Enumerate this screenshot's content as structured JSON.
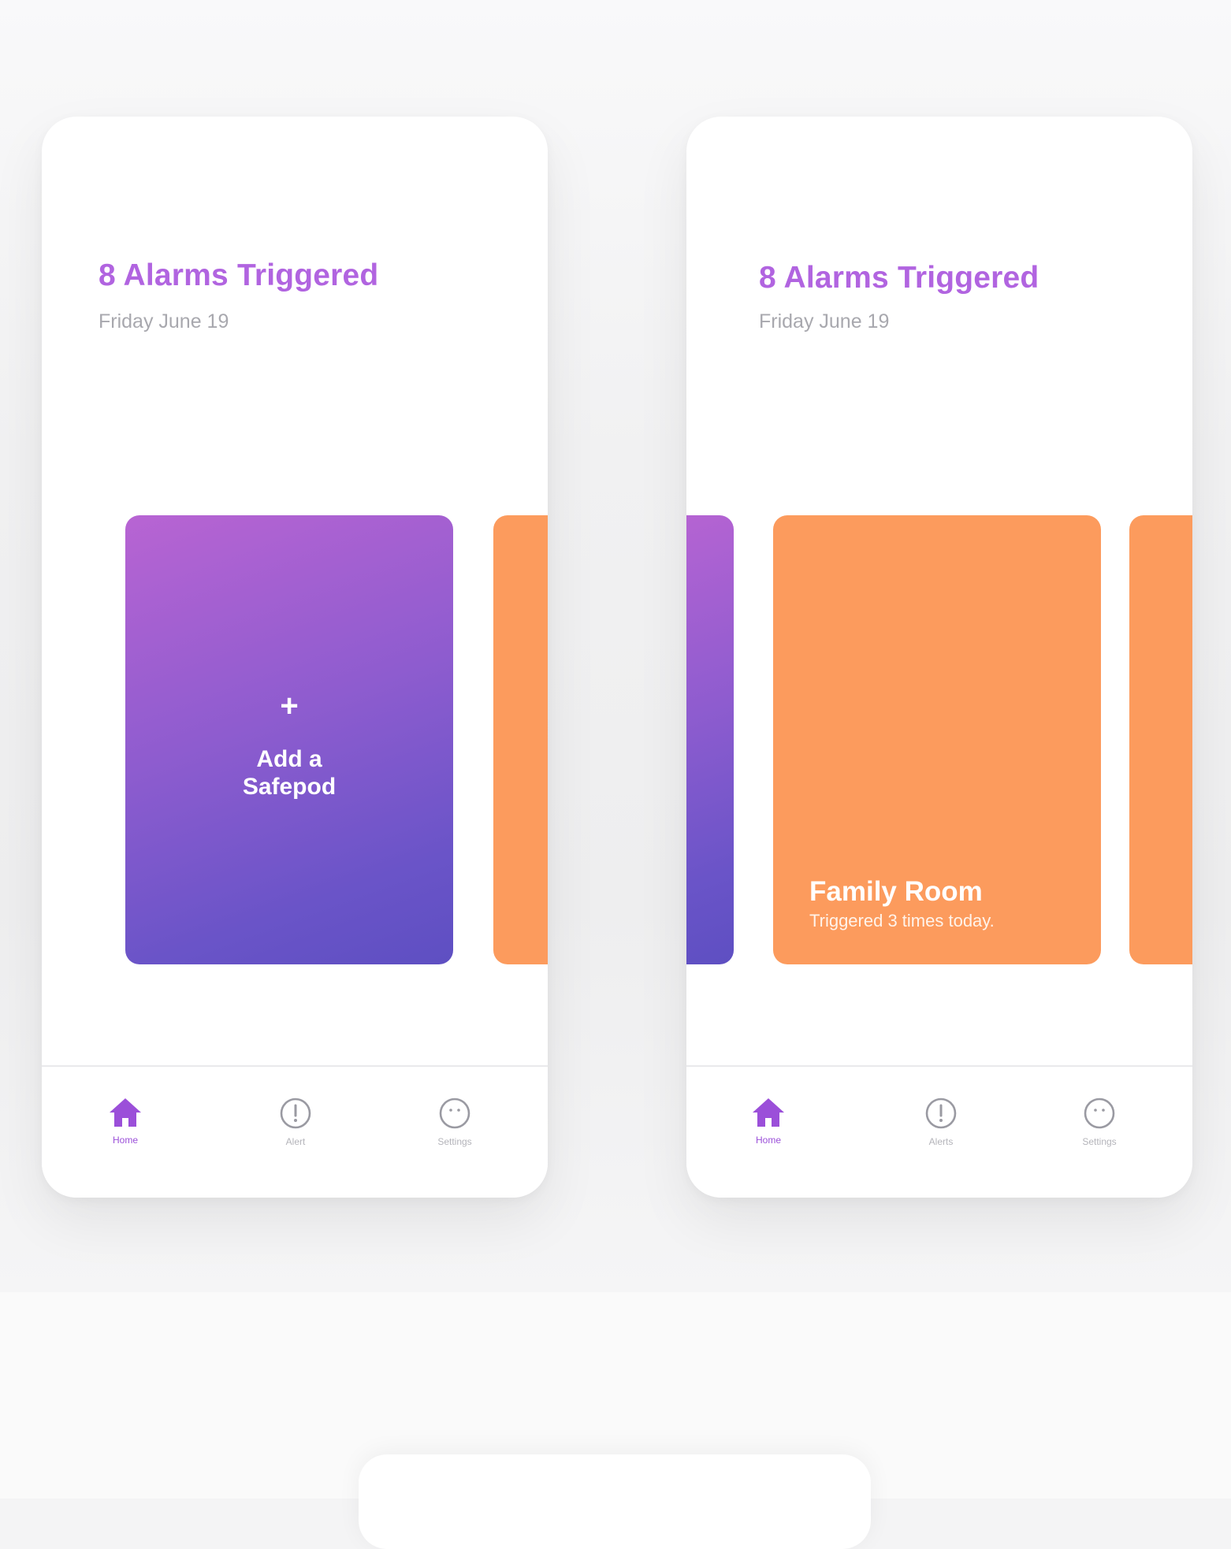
{
  "screens": [
    {
      "title": "8 Alarms Triggered",
      "date": "Friday June 19",
      "add_card": {
        "plus_symbol": "+",
        "label": "Add a Safepod"
      },
      "tabs": [
        {
          "label": "Home",
          "icon": "home-icon",
          "active": true
        },
        {
          "label": "Alert",
          "icon": "alert-icon",
          "active": false
        },
        {
          "label": "Settings",
          "icon": "settings-icon",
          "active": false
        }
      ]
    },
    {
      "title": "8 Alarms Triggered",
      "date": "Friday June 19",
      "room_card": {
        "name": "Family Room",
        "subtitle": "Triggered 3 times today."
      },
      "tabs": [
        {
          "label": "Home",
          "icon": "home-icon",
          "active": true
        },
        {
          "label": "Alerts",
          "icon": "alert-icon",
          "active": false
        },
        {
          "label": "Settings",
          "icon": "settings-icon",
          "active": false
        }
      ]
    }
  ],
  "colors": {
    "accent_purple": "#b164e0",
    "tab_active": "#9b4fd9",
    "card_orange": "#fc9b5d",
    "card_purple_start": "#b864d3",
    "card_purple_end": "#5e4fc2",
    "date_gray": "#a8a8ae"
  }
}
